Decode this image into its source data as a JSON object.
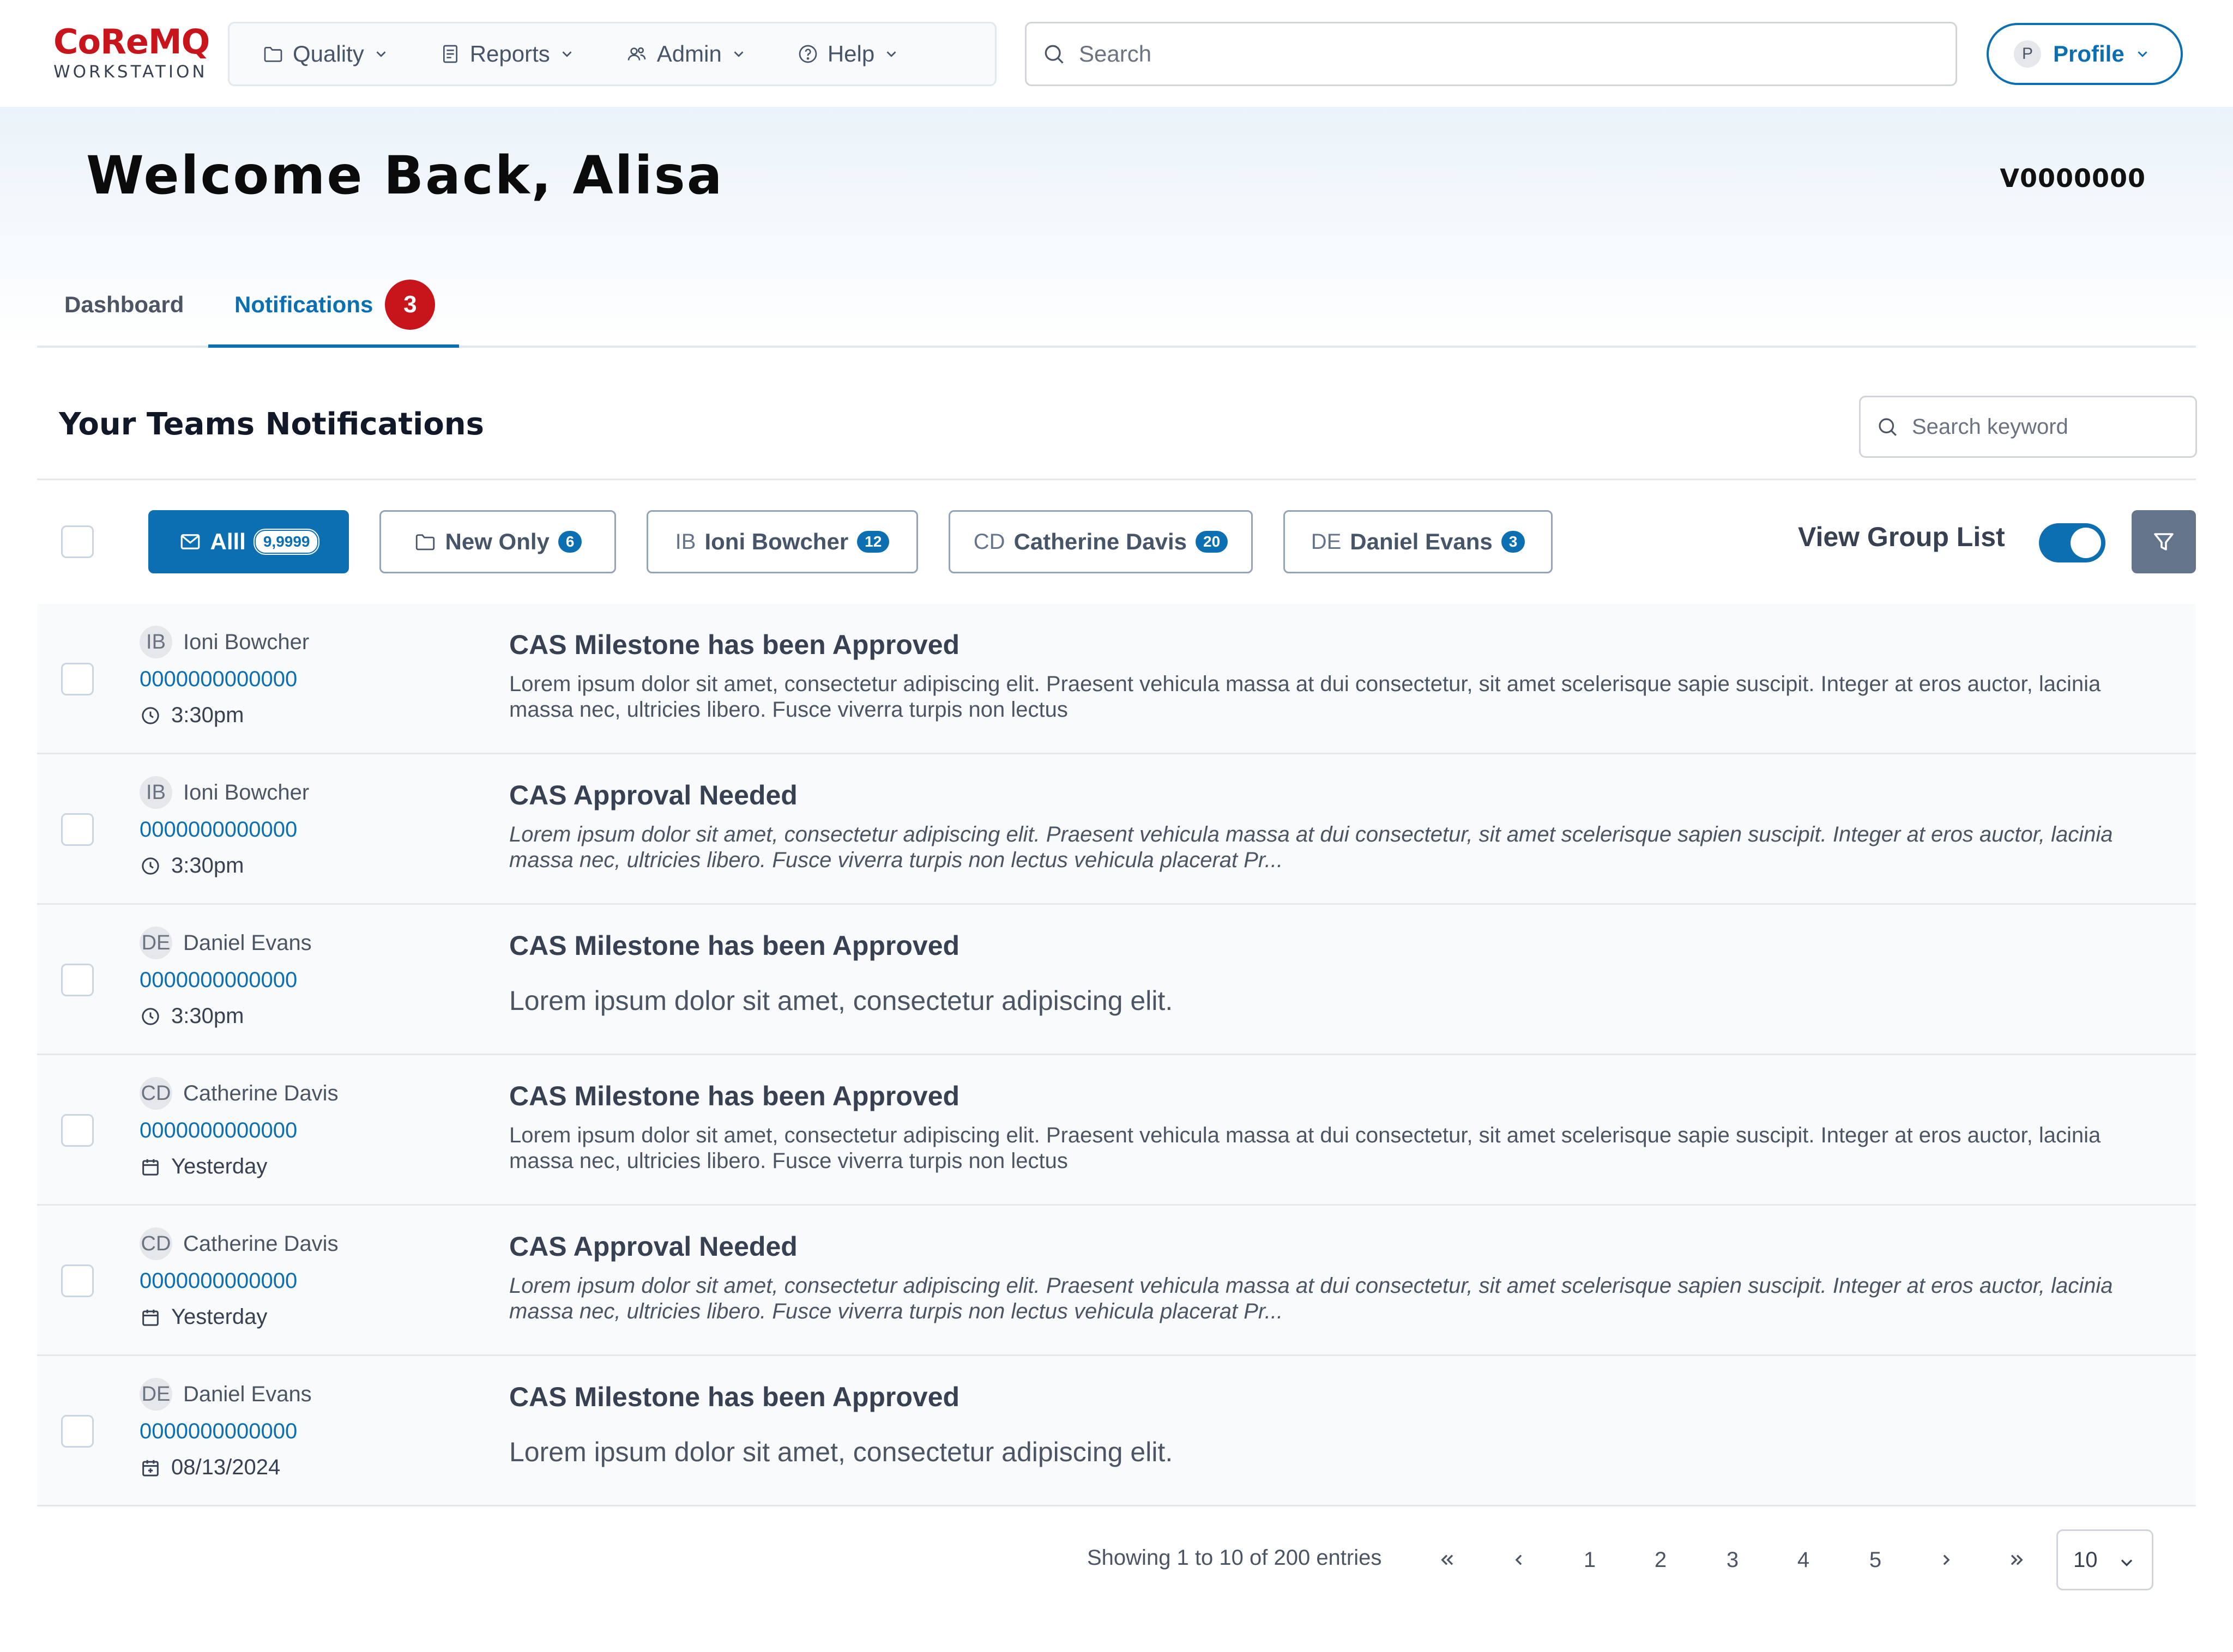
{
  "brand": {
    "name": "CoReMQ",
    "subtitle": "WORKSTATION"
  },
  "nav": {
    "menu": [
      {
        "label": "Quality",
        "icon": "folder-icon"
      },
      {
        "label": "Reports",
        "icon": "report-icon"
      },
      {
        "label": "Admin",
        "icon": "users-icon"
      },
      {
        "label": "Help",
        "icon": "help-icon"
      }
    ],
    "search_placeholder": "Search",
    "profile": {
      "initial": "P",
      "label": "Profile"
    }
  },
  "header": {
    "welcome": "Welcome Back, Alisa",
    "user_id": "V0000000"
  },
  "tabs": [
    {
      "label": "Dashboard",
      "active": false
    },
    {
      "label": "Notifications",
      "active": true,
      "badge": "3"
    }
  ],
  "section": {
    "title": "Your Teams Notifications",
    "keyword_placeholder": "Search keyword"
  },
  "filters": {
    "chips": [
      {
        "label": "Alll",
        "count": "9,9999",
        "icon": "mail-icon",
        "active": true
      },
      {
        "label": "New Only",
        "count": "6",
        "icon": "folder-icon"
      },
      {
        "initials": "IB",
        "label": "Ioni Bowcher",
        "count": "12"
      },
      {
        "initials": "CD",
        "label": "Catherine Davis",
        "count": "20"
      },
      {
        "initials": "DE",
        "label": "Daniel Evans",
        "count": "3"
      }
    ],
    "view_group_list": "View Group List",
    "view_group_list_on": true
  },
  "notifications": [
    {
      "initials": "IB",
      "sender": "Ioni Bowcher",
      "ref": "0000000000000",
      "time": "3:30pm",
      "time_icon": "clock-icon",
      "title": "CAS Milestone has been Approved",
      "body": "Lorem ipsum dolor sit amet, consectetur adipiscing elit. Praesent vehicula massa at dui consectetur, sit amet scelerisque sapie suscipit. Integer at eros auctor, lacinia massa nec, ultricies libero. Fusce viverra turpis non lectus",
      "style": "normal"
    },
    {
      "initials": "IB",
      "sender": "Ioni Bowcher",
      "ref": "0000000000000",
      "time": "3:30pm",
      "time_icon": "clock-icon",
      "title": "CAS Approval Needed",
      "body": "Lorem ipsum dolor sit amet, consectetur adipiscing elit. Praesent vehicula massa at dui consectetur, sit amet scelerisque sapien suscipit. Integer at eros auctor, lacinia massa nec, ultricies libero. Fusce viverra turpis non lectus vehicula placerat Pr...",
      "style": "italic"
    },
    {
      "initials": "DE",
      "sender": "Daniel Evans",
      "ref": "0000000000000",
      "time": "3:30pm",
      "time_icon": "clock-icon",
      "title": "CAS Milestone has been Approved",
      "body": "Lorem ipsum dolor sit amet, consectetur adipiscing elit.",
      "style": "big"
    },
    {
      "initials": "CD",
      "sender": "Catherine Davis",
      "ref": "0000000000000",
      "time": "Yesterday",
      "time_icon": "calendar-icon",
      "title": "CAS Milestone has been Approved",
      "body": "Lorem ipsum dolor sit amet, consectetur adipiscing elit. Praesent vehicula massa at dui consectetur, sit amet scelerisque sapie suscipit. Integer at eros auctor, lacinia massa nec, ultricies libero. Fusce viverra turpis non lectus",
      "style": "normal"
    },
    {
      "initials": "CD",
      "sender": "Catherine Davis",
      "ref": "0000000000000",
      "time": "Yesterday",
      "time_icon": "calendar-icon",
      "title": "CAS Approval Needed",
      "body": "Lorem ipsum dolor sit amet, consectetur adipiscing elit. Praesent vehicula massa at dui consectetur, sit amet scelerisque sapien suscipit. Integer at eros auctor, lacinia massa nec, ultricies libero. Fusce viverra turpis non lectus vehicula placerat Pr...",
      "style": "italic"
    },
    {
      "initials": "DE",
      "sender": "Daniel Evans",
      "ref": "0000000000000",
      "time": "08/13/2024",
      "time_icon": "calendar-date-icon",
      "title": "CAS Milestone has been Approved",
      "body": "Lorem ipsum dolor sit amet, consectetur adipiscing elit.",
      "style": "big"
    }
  ],
  "pagination": {
    "info": "Showing 1 to 10 of 200 entries",
    "pages": [
      "1",
      "2",
      "3",
      "4",
      "5"
    ],
    "first": "«",
    "prev": "‹",
    "next": "›",
    "last": "»",
    "page_size": "10"
  },
  "colors": {
    "brand_red": "#c8151c",
    "primary_blue": "#0b6fb1",
    "slate": "#64748b"
  }
}
